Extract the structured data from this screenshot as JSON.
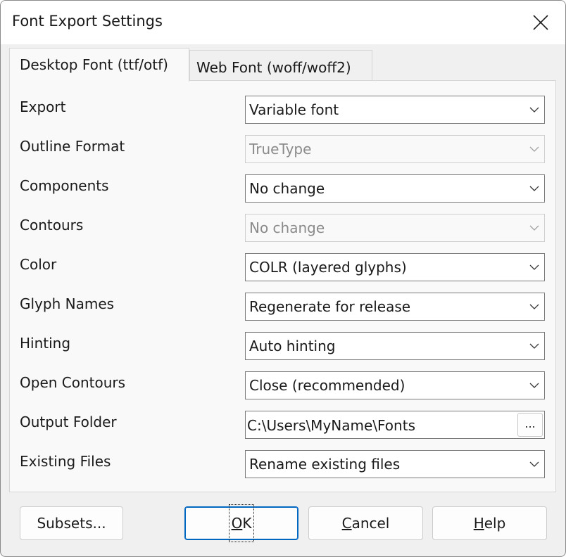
{
  "window": {
    "title": "Font Export Settings"
  },
  "tabs": [
    {
      "label": "Desktop Font (ttf/otf)",
      "active": true
    },
    {
      "label": "Web Font (woff/woff2)",
      "active": false
    }
  ],
  "settings": [
    {
      "label": "Export",
      "value": "Variable font",
      "enabled": true
    },
    {
      "label": "Outline Format",
      "value": "TrueType",
      "enabled": false
    },
    {
      "label": "Components",
      "value": "No change",
      "enabled": true
    },
    {
      "label": "Contours",
      "value": "No change",
      "enabled": false
    },
    {
      "label": "Color",
      "value": "COLR (layered glyphs)",
      "enabled": true
    },
    {
      "label": "Glyph Names",
      "value": "Regenerate for release",
      "enabled": true
    },
    {
      "label": "Hinting",
      "value": "Auto hinting",
      "enabled": true
    },
    {
      "label": "Open Contours",
      "value": "Close (recommended)",
      "enabled": true
    }
  ],
  "output_folder": {
    "label": "Output Folder",
    "value": "C:\\Users\\MyName\\Fonts",
    "browse_label": "..."
  },
  "existing_files": {
    "label": "Existing Files",
    "value": "Rename existing files"
  },
  "buttons": {
    "subsets": "Subsets...",
    "ok": {
      "accel": "O",
      "rest": "K"
    },
    "cancel": {
      "accel": "C",
      "rest": "ancel"
    },
    "help": {
      "accel": "H",
      "rest": "elp"
    }
  },
  "colors": {
    "accent": "#0067c0",
    "window_bg": "#f0f0f0",
    "panel_bg": "#f9f9f9"
  },
  "icons": {
    "close": "close-icon",
    "dropdown": "chevron-down-icon"
  }
}
